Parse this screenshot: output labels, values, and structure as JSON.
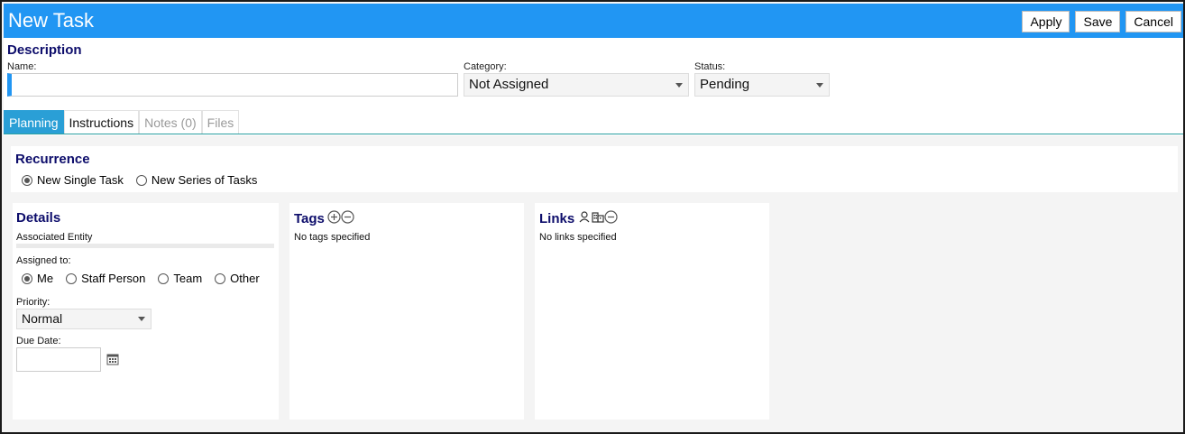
{
  "header": {
    "title": "New Task",
    "apply_label": "Apply",
    "save_label": "Save",
    "cancel_label": "Cancel"
  },
  "description": {
    "title": "Description",
    "name_label": "Name:",
    "name_value": "",
    "category_label": "Category:",
    "category_value": "Not Assigned",
    "status_label": "Status:",
    "status_value": "Pending"
  },
  "tabs": [
    {
      "label": "Planning",
      "state": "active"
    },
    {
      "label": "Instructions",
      "state": "normal"
    },
    {
      "label": "Notes (0)",
      "state": "disabled"
    },
    {
      "label": "Files",
      "state": "disabled"
    }
  ],
  "recurrence": {
    "title": "Recurrence",
    "options": [
      "New Single Task",
      "New Series of Tasks"
    ],
    "selected": "New Single Task"
  },
  "details": {
    "title": "Details",
    "associated_entity_label": "Associated Entity",
    "assigned_to_label": "Assigned to:",
    "assigned_options": [
      "Me",
      "Staff Person",
      "Team",
      "Other"
    ],
    "assigned_selected": "Me",
    "priority_label": "Priority:",
    "priority_value": "Normal",
    "due_date_label": "Due Date:",
    "due_date_value": ""
  },
  "tags": {
    "title": "Tags",
    "empty_text": "No tags specified",
    "icons": [
      "add-circle-icon",
      "remove-circle-icon"
    ]
  },
  "links": {
    "title": "Links",
    "empty_text": "No links specified",
    "icons": [
      "person-icon",
      "building-icon",
      "remove-circle-icon"
    ]
  },
  "colors": {
    "header_blue": "#2196f3",
    "tab_active": "#2a9fd6",
    "section_title": "#0d0d6b"
  }
}
